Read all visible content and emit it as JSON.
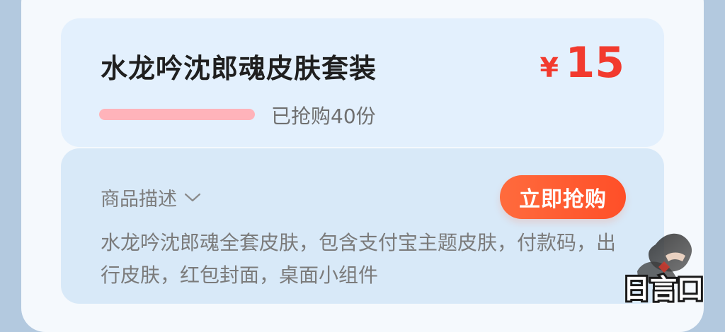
{
  "product": {
    "title": "水龙吟沈郎魂皮肤套装",
    "price_currency": "¥",
    "price_value": "15",
    "sold_text": "已抢购40份",
    "progress_fraction": 1
  },
  "actions": {
    "buy_label": "立即抢购"
  },
  "description": {
    "toggle_label": "商品描述",
    "text": "水龙吟沈郎魂全套皮肤，包含支付宝主题皮肤，付款码，出行皮肤，红包封面，桌面小组件"
  },
  "watermark": {
    "text": "日言口"
  },
  "icons": {
    "chevron": "chevron-down-icon",
    "watermark": "watermark-logo"
  },
  "colors": {
    "background": "#b3c9df",
    "card": "#f5f9fd",
    "top_panel": "#e3f0fd",
    "bottom_panel": "#d8e9f8",
    "price": "#f23a2e",
    "progress": "#ffb3ba",
    "button": "#ff5a2f"
  }
}
